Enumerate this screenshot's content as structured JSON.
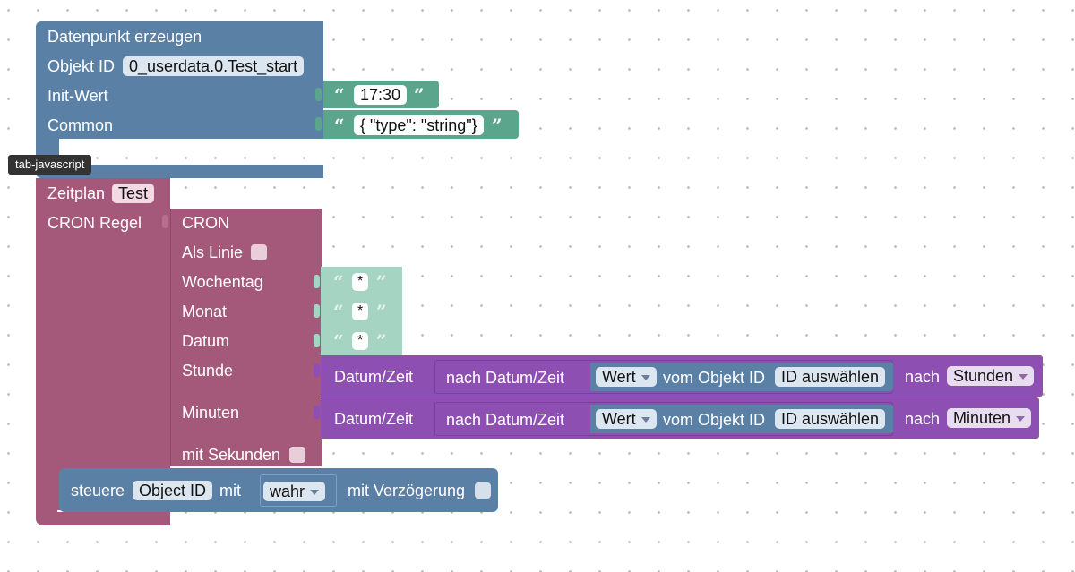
{
  "create_block": {
    "title": "Datenpunkt erzeugen",
    "object_id_label": "Objekt ID",
    "object_id_value": "0_userdata.0.Test_start",
    "init_label": "Init-Wert",
    "init_value": "17:30",
    "common_label": "Common",
    "common_value": "{ \"type\": \"string\"}"
  },
  "tooltip": "tab-javascript",
  "schedule_block": {
    "label": "Zeitplan",
    "name": "Test",
    "cron_rule_label": "CRON Regel"
  },
  "cron_block": {
    "title": "CRON",
    "as_line_label": "Als Linie",
    "weekday_label": "Wochentag",
    "weekday_value": "*",
    "month_label": "Monat",
    "month_value": "*",
    "date_label": "Datum",
    "date_value": "*",
    "hour_label": "Stunde",
    "minutes_label": "Minuten",
    "seconds_label": "mit Sekunden"
  },
  "datetime_hours": {
    "label": "Datum/Zeit",
    "inner_label": "nach Datum/Zeit",
    "value_option": "Wert",
    "from_object_label": "vom Objekt ID",
    "select_id": "ID auswählen",
    "after_label": "nach",
    "unit": "Stunden"
  },
  "datetime_minutes": {
    "label": "Datum/Zeit",
    "inner_label": "nach Datum/Zeit",
    "value_option": "Wert",
    "from_object_label": "vom Objekt ID",
    "select_id": "ID auswählen",
    "after_label": "nach",
    "unit": "Minuten"
  },
  "control_block": {
    "label": "steuere",
    "object_id": "Object ID",
    "with_label": "mit",
    "value": "wahr",
    "delay_label": "mit Verzögerung"
  },
  "colors": {
    "blue_block": "#5b80a5",
    "green_block": "#5ba58c",
    "magenta_block": "#a5597a",
    "purple_block": "#8d4fb1"
  }
}
